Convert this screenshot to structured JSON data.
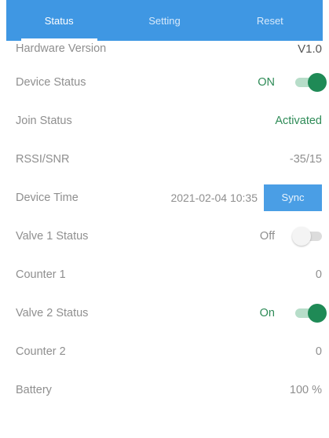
{
  "tabs": [
    {
      "label": "Status"
    },
    {
      "label": "Setting"
    },
    {
      "label": "Reset"
    }
  ],
  "rows": {
    "hardware_version": {
      "label": "Hardware Version",
      "value": "V1.0"
    },
    "device_status": {
      "label": "Device Status",
      "value": "ON",
      "toggle": "on"
    },
    "join_status": {
      "label": "Join Status",
      "value": "Activated"
    },
    "rssi_snr": {
      "label": "RSSI/SNR",
      "value": "-35/15"
    },
    "device_time": {
      "label": "Device Time",
      "value": "2021-02-04 10:35",
      "button": "Sync"
    },
    "valve1_status": {
      "label": "Valve 1 Status",
      "value": "Off",
      "toggle": "off"
    },
    "counter1": {
      "label": "Counter 1",
      "value": "0"
    },
    "valve2_status": {
      "label": "Valve 2 Status",
      "value": "On",
      "toggle": "on"
    },
    "counter2": {
      "label": "Counter 2",
      "value": "0"
    },
    "battery": {
      "label": "Battery",
      "value": "100 %"
    }
  },
  "colors": {
    "tab_bar": "#3f97e3",
    "toggle_on": "#1f8a56",
    "sync_button": "#4a9ee5",
    "status_green": "#2e8b57"
  }
}
